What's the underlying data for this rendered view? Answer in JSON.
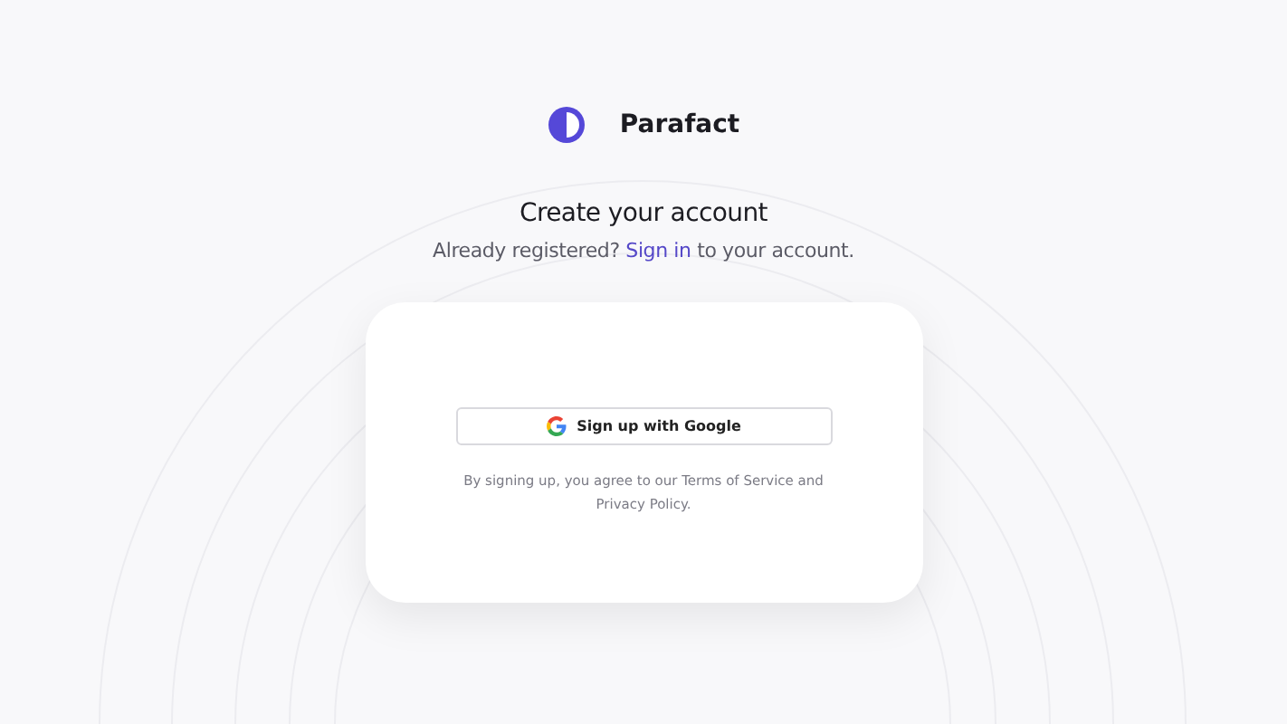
{
  "brand": {
    "name": "Parafact"
  },
  "heading": "Create your account",
  "subtitle": {
    "before": "Already registered?",
    "link": "Sign in",
    "after": "to your account."
  },
  "google_button": {
    "label": "Sign up with Google"
  },
  "terms": "By signing up, you agree to our Terms of Service and Privacy Policy."
}
